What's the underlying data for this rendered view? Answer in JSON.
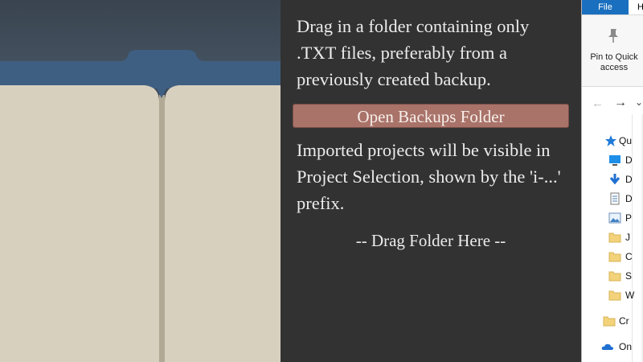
{
  "import_panel": {
    "instructions": "Drag in a folder containing only .TXT files, preferably from a previously created  backup.",
    "open_button_label": "Open Backups Folder",
    "imported_note": "Imported projects will be visible in Project Selection, shown by the 'i-...' prefix.",
    "drop_zone_text": "-- Drag Folder Here --"
  },
  "explorer": {
    "tabs": [
      "File",
      "H"
    ],
    "ribbon": {
      "pin_label": "Pin to Quick access",
      "pin_icon": "pin-icon"
    },
    "nav": {
      "back_icon": "arrow-left-icon",
      "forward_icon": "arrow-right-icon",
      "expand_icon": "chevron-down-icon"
    },
    "tree": [
      {
        "label": "Qu",
        "icon": "star-icon"
      },
      {
        "label": "D",
        "icon": "desktop-icon"
      },
      {
        "label": "D",
        "icon": "download-icon"
      },
      {
        "label": "D",
        "icon": "document-icon"
      },
      {
        "label": "P",
        "icon": "picture-icon"
      },
      {
        "label": "J",
        "icon": "folder-icon"
      },
      {
        "label": "C",
        "icon": "folder-icon"
      },
      {
        "label": "S",
        "icon": "folder-icon"
      },
      {
        "label": "W",
        "icon": "folder-icon"
      },
      {
        "label": "Cr",
        "icon": "folder-icon"
      },
      {
        "label": "On",
        "icon": "cloud-icon"
      }
    ]
  },
  "colors": {
    "panel_bg": "#323232",
    "button_bg": "#a9736a",
    "book_page": "#d8d0bf",
    "book_cover": "#3e5f82",
    "accent_blue": "#1a6fbf"
  }
}
